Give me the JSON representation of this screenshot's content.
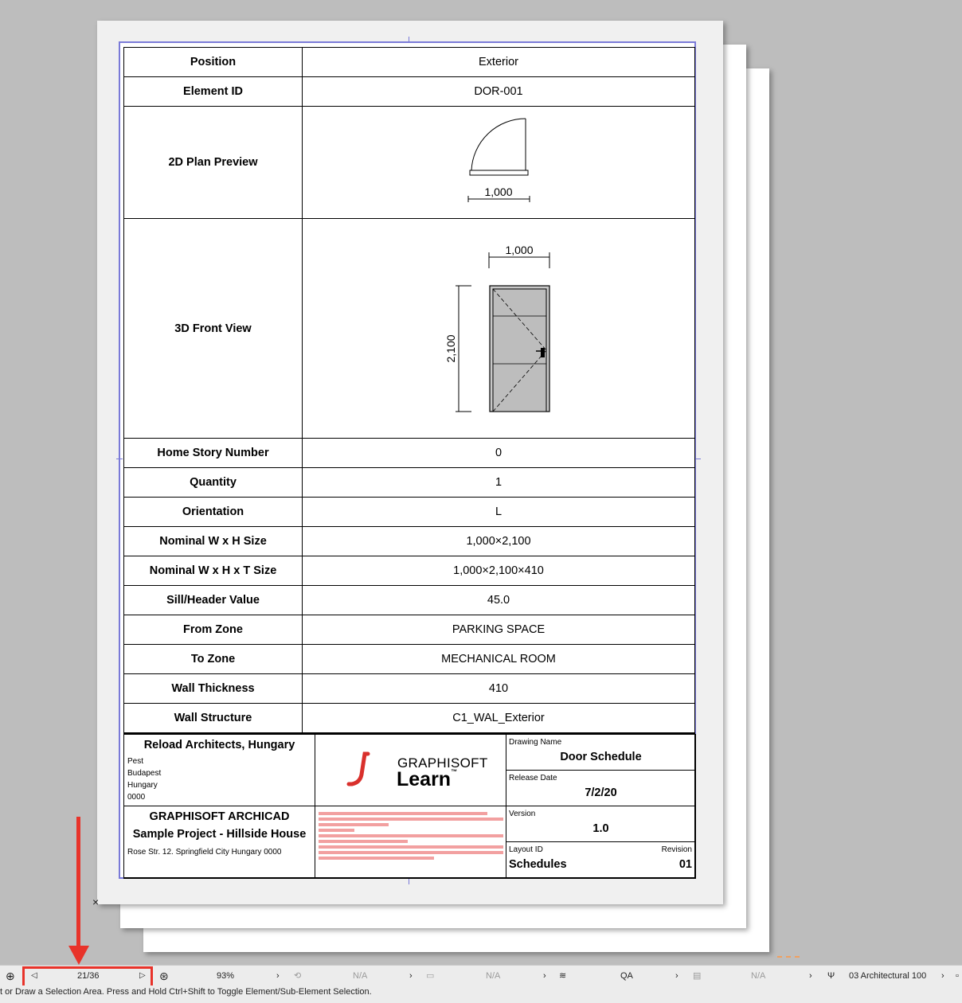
{
  "schedule": {
    "rows": [
      {
        "label": "Position",
        "value": "Exterior"
      },
      {
        "label": "Element ID",
        "value": "DOR-001"
      },
      {
        "label": "2D Plan Preview",
        "value": ""
      },
      {
        "label": "3D Front View",
        "value": ""
      },
      {
        "label": "Home Story Number",
        "value": "0"
      },
      {
        "label": "Quantity",
        "value": "1"
      },
      {
        "label": "Orientation",
        "value": "L"
      },
      {
        "label": "Nominal W x H Size",
        "value": "1,000×2,100"
      },
      {
        "label": "Nominal W x H x T Size",
        "value": "1,000×2,100×410"
      },
      {
        "label": "Sill/Header Value",
        "value": "45.0"
      },
      {
        "label": "From Zone",
        "value": "PARKING SPACE"
      },
      {
        "label": "To Zone",
        "value": "MECHANICAL ROOM"
      },
      {
        "label": "Wall Thickness",
        "value": "410"
      },
      {
        "label": "Wall Structure",
        "value": "C1_WAL_Exterior"
      }
    ],
    "plan_dimension": "1,000",
    "front_width_dimension": "1,000",
    "front_height_dimension": "2,100"
  },
  "title_block": {
    "firm_name": "Reload Architects, Hungary",
    "firm_address": [
      "Pest",
      "Budapest",
      "Hungary",
      "0000"
    ],
    "logo_brand": "GRAPHISOFT",
    "logo_product": "Learn",
    "logo_tm": "™",
    "project_line1": "GRAPHISOFT ARCHICAD",
    "project_line2": "Sample Project - Hillside House",
    "project_address": "Rose Str. 12. Springfield City Hungary 0000",
    "drawing_name_label": "Drawing Name",
    "drawing_name": "Door Schedule",
    "release_date_label": "Release Date",
    "release_date": "7/2/20",
    "version_label": "Version",
    "version": "1.0",
    "layout_id_label": "Layout ID",
    "layout_id": "Schedules",
    "revision_label": "Revision",
    "revision": "01"
  },
  "status_bar": {
    "page_indicator": "21/36",
    "zoom": "93%",
    "field2": "N/A",
    "field3": "N/A",
    "layer_combo": "QA",
    "field5": "N/A",
    "pen_set": "03 Architectural 100",
    "hint": "t or Draw a Selection Area. Press and Hold Ctrl+Shift to Toggle Element/Sub-Element Selection."
  },
  "colors": {
    "highlight": "#e8332a",
    "frame": "#7a7ad8",
    "redacted": "#f2a0a0",
    "logo_red": "#d9302c"
  }
}
